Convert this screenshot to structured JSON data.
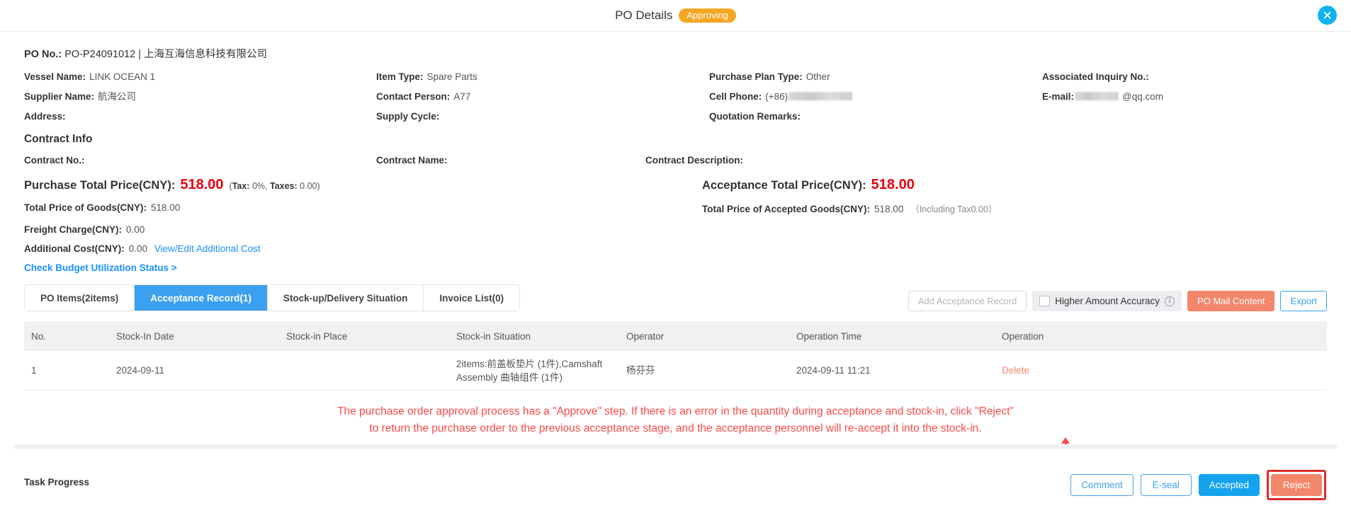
{
  "header": {
    "title": "PO Details",
    "status": "Approving",
    "close_icon": "close-icon"
  },
  "po_no": {
    "label": "PO No.:",
    "value": "PO-P24091012 | 上海互海信息科技有限公司"
  },
  "info_fields": [
    {
      "key": "Vessel Name:",
      "value": "LINK OCEAN 1"
    },
    {
      "key": "Item Type:",
      "value": "Spare Parts"
    },
    {
      "key": "Purchase Plan Type:",
      "value": "Other"
    },
    {
      "key": "Associated Inquiry No.:",
      "value": ""
    },
    {
      "key": "Supplier Name:",
      "value": "航海公司"
    },
    {
      "key": "Contact Person:",
      "value": "A77"
    },
    {
      "key": "Cell Phone:",
      "value": "(+86)",
      "masked": "m1"
    },
    {
      "key": "E-mail:",
      "value": "@qq.com",
      "masked": "m2",
      "masked_before": true
    },
    {
      "key": "Address:",
      "value": ""
    },
    {
      "key": "Supply Cycle:",
      "value": ""
    },
    {
      "key": "Quotation Remarks:",
      "value": ""
    },
    {
      "key": "",
      "value": ""
    }
  ],
  "contract": {
    "section_title": "Contract Info",
    "contract_no_label": "Contract No.:",
    "contract_name_label": "Contract Name:",
    "contract_desc_label": "Contract Description:"
  },
  "prices": {
    "purchase_total_label": "Purchase Total Price(CNY):",
    "purchase_total_value": "518.00",
    "tax_prefix": "(",
    "tax_label": "Tax:",
    "tax_value": "0%,",
    "taxes_label": "Taxes:",
    "taxes_value": "0.00",
    "tax_suffix": ")",
    "acceptance_total_label": "Acceptance Total Price(CNY):",
    "acceptance_total_value": "518.00",
    "goods_label": "Total Price of Goods(CNY):",
    "goods_value": "518.00",
    "accepted_goods_label": "Total Price of Accepted Goods(CNY):",
    "accepted_goods_value": "518.00",
    "accepted_goods_tax": "（Including Tax0.00）",
    "freight_label": "Freight Charge(CNY):",
    "freight_value": "0.00",
    "additional_label": "Additional Cost(CNY):",
    "additional_value": "0.00",
    "additional_link": "View/Edit Additional Cost",
    "budget_link": "Check Budget Utilization Status >"
  },
  "tabs": [
    {
      "label": "PO Items(2items)",
      "active": false
    },
    {
      "label": "Acceptance Record(1)",
      "active": true
    },
    {
      "label": "Stock-up/Delivery Situation",
      "active": false
    },
    {
      "label": "Invoice List(0)",
      "active": false
    }
  ],
  "tab_actions": {
    "add_acceptance_record": "Add Acceptance Record",
    "higher_amount_accuracy": "Higher Amount Accuracy",
    "info_icon": "info-icon",
    "po_mail_content": "PO Mail Content",
    "export": "Export"
  },
  "table": {
    "columns": [
      "No.",
      "Stock-In Date",
      "Stock-in Place",
      "Stock-in Situation",
      "Operator",
      "Operation Time",
      "Operation"
    ],
    "rows": [
      {
        "no": "1",
        "stock_in_date": "2024-09-11",
        "stock_in_place": "",
        "stock_in_situation": "2items:前盖板垫片 (1件),Camshaft Assembly 曲轴组件 (1件)",
        "operator": "杨芬芬",
        "operation_time": "2024-09-11 11:21",
        "operation": "Delete"
      }
    ]
  },
  "annotation": {
    "line1": "The purchase order approval process has a \"Approve\" step. If there is an error in the quantity during acceptance and stock-in, click \"Reject\"",
    "line2": "to return the purchase order to the previous acceptance stage, and the acceptance personnel will re-accept it into the stock-in."
  },
  "footer": {
    "task_progress": "Task Progress",
    "buttons": [
      {
        "label": "Comment",
        "style": "outline"
      },
      {
        "label": "E-seal",
        "style": "outline"
      },
      {
        "label": "Accepted",
        "style": "primary"
      },
      {
        "label": "Reject",
        "style": "reject"
      }
    ]
  },
  "colors": {
    "accent_blue": "#3ba0ef",
    "status_orange": "#f5a623",
    "price_red": "#e60012",
    "reject_orange": "#f4866a",
    "annotation_red": "#fa4a4a"
  }
}
